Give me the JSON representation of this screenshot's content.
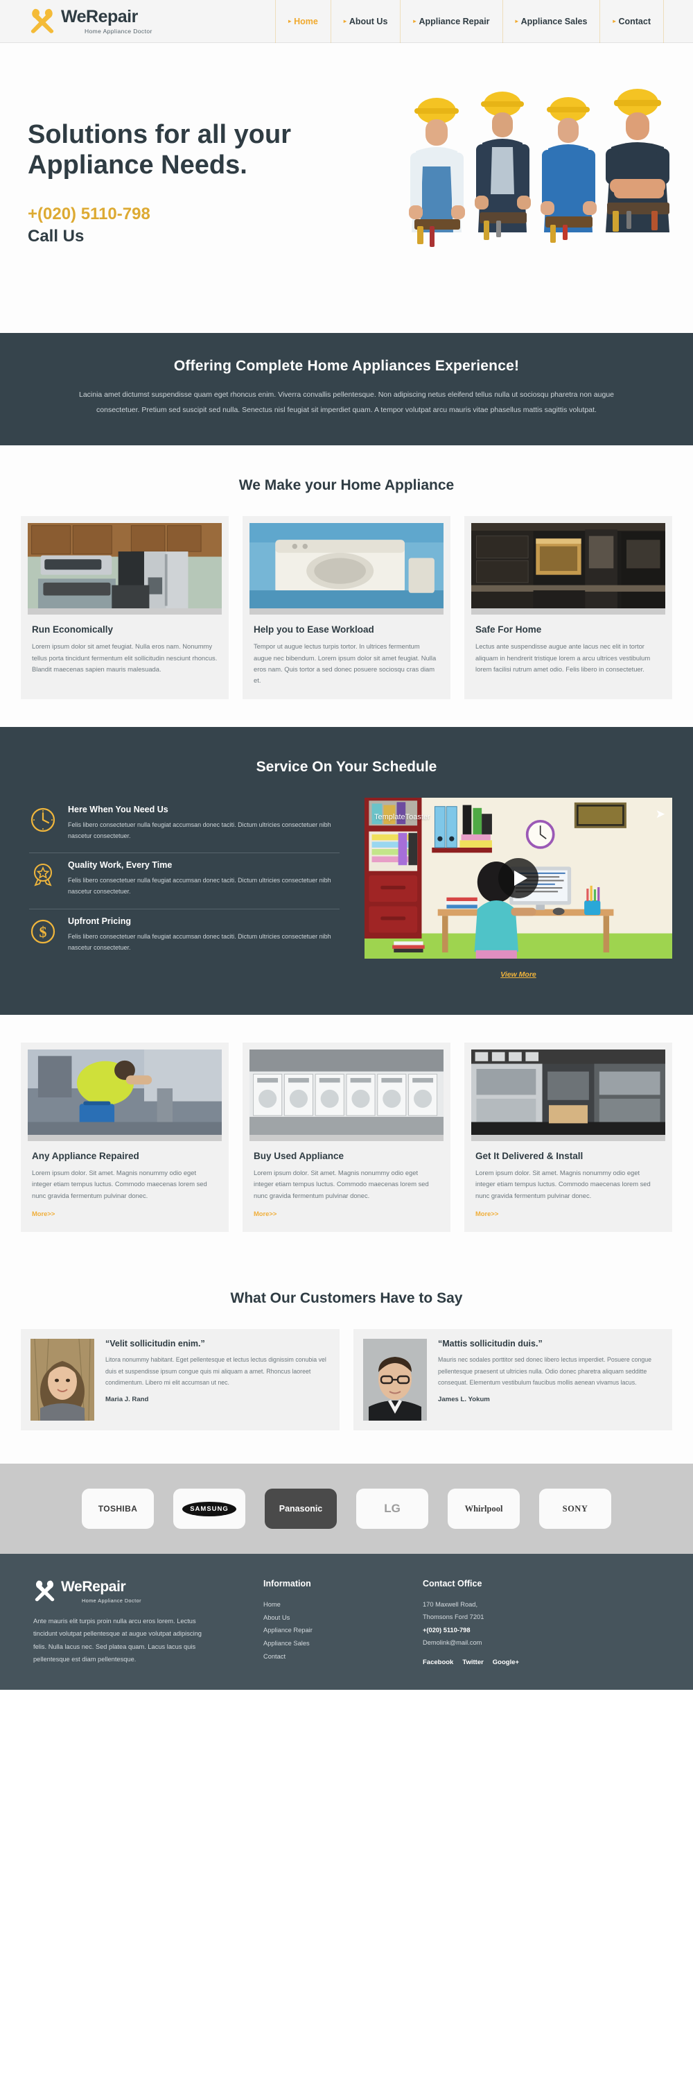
{
  "header": {
    "brand": {
      "name": "WeRepair",
      "tagline": "Home Appliance Doctor",
      "logo_icon": "crossed-wrench-screwdriver-icon"
    },
    "nav": [
      {
        "label": "Home",
        "active": true
      },
      {
        "label": "About Us",
        "active": false
      },
      {
        "label": "Appliance Repair",
        "active": false
      },
      {
        "label": "Appliance Sales",
        "active": false
      },
      {
        "label": "Contact",
        "active": false
      }
    ]
  },
  "hero": {
    "title": "Solutions for all your Appliance Needs.",
    "phone": "+(020) 5110-798",
    "call_label": "Call Us"
  },
  "banner": {
    "title": "Offering Complete Home Appliances Experience!",
    "text": "Lacinia amet dictumst suspendisse quam eget rhoncus enim. Viverra convallis pellentesque. Non adipiscing netus eleifend tellus nulla ut sociosqu pharetra non augue consectetuer. Pretium sed suscipit sed nulla. Senectus nisl feugiat sit imperdiet quam. A tempor volutpat arcu mauris vitae phasellus mattis sagittis volutpat."
  },
  "make_section": {
    "title": "We Make your Home Appliance",
    "cards": [
      {
        "title": "Run Economically",
        "text": "Lorem ipsum dolor sit amet feugiat. Nulla eros nam. Nonummy tellus porta tincidunt fermentum elit sollicitudin nesciunt rhoncus. Blandit maecenas sapien mauris malesuada.",
        "image": "kitchen-with-stainless-appliances-photo"
      },
      {
        "title": "Help you to Ease Workload",
        "text": "Tempor ut augue lectus turpis tortor. In ultrices fermentum augue nec bibendum. Lorem ipsum dolor sit amet feugiat. Nulla eros nam. Quis tortor a sed donec posuere sociosqu cras diam et.",
        "image": "washing-machine-photo"
      },
      {
        "title": "Safe For Home",
        "text": "Lectus ante suspendisse augue ante lacus nec elit in tortor aliquam in hendrerit tristique lorem a arcu ultrices vestibulum lorem facilisi rutrum amet odio. Felis libero in consectetuer.",
        "image": "dark-modern-kitchen-photo"
      }
    ]
  },
  "schedule": {
    "title": "Service On Your Schedule",
    "features": [
      {
        "icon": "clock-icon",
        "title": "Here When You Need Us",
        "text": "Felis libero consectetuer nulla feugiat accumsan donec taciti.  Dictum ultricies consectetuer nibh nascetur consectetuer."
      },
      {
        "icon": "award-ribbon-icon",
        "title": "Quality Work, Every Time",
        "text": "Felis libero consectetuer nulla feugiat accumsan donec taciti.  Dictum ultricies consectetuer nibh nascetur consectetuer."
      },
      {
        "icon": "dollar-coin-icon",
        "title": "Upfront Pricing",
        "text": "Felis libero consectetuer nulla feugiat accumsan donec taciti.  Dictum ultricies consectetuer nibh nascetur consectetuer."
      }
    ],
    "video": {
      "watermark": "TemplateToaster",
      "play_icon": "play-button-icon",
      "share_icon": "share-arrow-icon"
    },
    "view_more": "View More"
  },
  "services": {
    "cards": [
      {
        "title": "Any Appliance Repaired",
        "text": "Lorem ipsum dolor. Sit amet. Magnis nonummy odio eget integer etiam tempus luctus. Commodo maecenas lorem sed nunc gravida fermentum pulvinar donec.",
        "more": "More>>",
        "image": "technician-repairing-appliance-photo"
      },
      {
        "title": "Buy Used Appliance",
        "text": "Lorem ipsum dolor. Sit amet. Magnis nonummy odio eget integer etiam tempus luctus. Commodo maecenas lorem sed nunc gravida fermentum pulvinar donec.",
        "more": "More>>",
        "image": "row-of-washing-machines-photo"
      },
      {
        "title": "Get It Delivered & Install",
        "text": "Lorem ipsum dolor. Sit amet. Magnis nonummy odio eget integer etiam tempus luctus. Commodo maecenas lorem sed nunc gravida fermentum pulvinar donec.",
        "more": "More>>",
        "image": "appliance-showroom-photo"
      }
    ]
  },
  "testimonials": {
    "title": "What Our Customers Have to Say",
    "items": [
      {
        "quote": "“Velit sollicitudin enim.”",
        "text": "Litora nonummy habitant. Eget pellentesque et lectus lectus dignissim conubia vel duis et suspendisse ipsum congue quis mi aliquam a amet. Rhoncus laoreet condimentum. Libero mi elit accumsan ut nec.",
        "name": "Maria J. Rand",
        "avatar": "woman-portrait-photo"
      },
      {
        "quote": "“Mattis sollicitudin duis.”",
        "text": "Mauris nec sodales porttitor sed donec libero lectus imperdiet. Posuere congue pellentesque praesent ut ultricies nulla. Odio donec pharetra aliquam sedditte consequat. Elementum vestibulum faucibus mollis aenean vivamus lacus.",
        "name": "James L. Yokum",
        "avatar": "man-with-glasses-portrait-photo"
      }
    ]
  },
  "brands": [
    {
      "label": "TOSHIBA",
      "style": "light"
    },
    {
      "label": "SAMSUNG",
      "style": "light"
    },
    {
      "label": "Panasonic",
      "style": "dark"
    },
    {
      "label": "LG",
      "style": "light"
    },
    {
      "label": "Whirlpool",
      "style": "light"
    },
    {
      "label": "SONY",
      "style": "light"
    }
  ],
  "footer": {
    "brand": {
      "name": "WeRepair",
      "tagline": "Home Appliance Doctor"
    },
    "about": "Ante mauris elit turpis proin nulla arcu eros lorem. Lectus tincidunt volutpat pellentesque at augue volutpat adipiscing felis. Nulla lacus nec. Sed platea quam. Lacus lacus quis pellentesque est diam pellentesque.",
    "information": {
      "heading": "Information",
      "links": [
        "Home",
        "About Us",
        "Appliance Repair",
        "Appliance Sales",
        "Contact"
      ]
    },
    "contact": {
      "heading": "Contact Office",
      "address_line1": "170 Maxwell Road,",
      "address_line2": "Thomsons Ford 7201",
      "phone": "+(020) 5110-798",
      "email": "Demolink@mail.com",
      "social": [
        "Facebook",
        "Twitter",
        "Google+"
      ]
    }
  },
  "colors": {
    "accent": "#f0a92e",
    "dark": "#36444c",
    "footer": "#46545c",
    "card_bg": "#f1f1f1",
    "brands_bg": "#c9c9c9"
  }
}
